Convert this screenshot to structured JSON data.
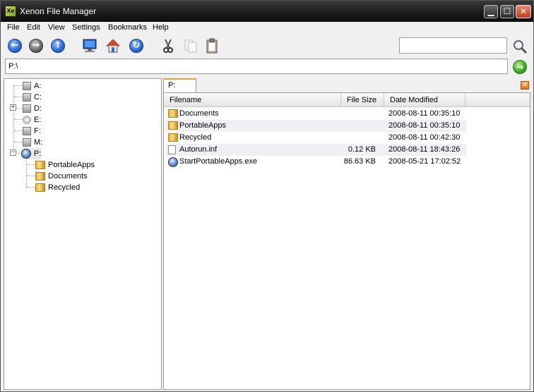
{
  "window": {
    "title": "Xenon File Manager",
    "app_icon_text": "Xe",
    "minimize_glyph": "▁",
    "maximize_glyph": "☐",
    "close_glyph": "✕"
  },
  "menu": [
    "File",
    "Edit",
    "View",
    "Settings",
    "Bookmarks",
    "Help"
  ],
  "toolbar": {
    "buttons": [
      {
        "name": "back",
        "icon": "arrow-left-icon",
        "glyph": "←"
      },
      {
        "name": "forward",
        "icon": "arrow-right-icon",
        "glyph": "→"
      },
      {
        "name": "up",
        "icon": "arrow-up-icon",
        "glyph": "↑"
      },
      {
        "name": "computer",
        "icon": "monitor-icon"
      },
      {
        "name": "home",
        "icon": "home-icon"
      },
      {
        "name": "refresh",
        "icon": "refresh-icon",
        "glyph": "↻"
      },
      {
        "name": "cut",
        "icon": "scissors-icon"
      },
      {
        "name": "copy",
        "icon": "copy-icon"
      },
      {
        "name": "paste",
        "icon": "clipboard-icon"
      }
    ],
    "search_value": "",
    "search_icon": "magnifier-icon"
  },
  "address": {
    "path": "P:\\",
    "go_icon": "go-arrow-icon",
    "go_glyph": "→"
  },
  "tree": {
    "drives": [
      {
        "label": "A:",
        "type": "drive",
        "expander": ""
      },
      {
        "label": "C:",
        "type": "drive",
        "expander": ""
      },
      {
        "label": "D:",
        "type": "drive",
        "expander": "+"
      },
      {
        "label": "E:",
        "type": "cd",
        "expander": ""
      },
      {
        "label": "F:",
        "type": "drive",
        "expander": ""
      },
      {
        "label": "M:",
        "type": "drive",
        "expander": ""
      },
      {
        "label": "P:",
        "type": "portable",
        "expander": "−"
      }
    ],
    "children": [
      "PortableApps",
      "Documents",
      "Recycled"
    ]
  },
  "tab": {
    "label": "P:",
    "close_glyph": "✕"
  },
  "list": {
    "columns": [
      "Filename",
      "File Size",
      "Date Modified"
    ],
    "rows": [
      {
        "name": "Documents",
        "size": "",
        "date": "2008-08-11 00:35:10",
        "icon": "folder-icon"
      },
      {
        "name": "PortableApps",
        "size": "",
        "date": "2008-08-11 00:35:10",
        "icon": "folder-icon"
      },
      {
        "name": "Recycled",
        "size": "",
        "date": "2008-08-11 00:42:30",
        "icon": "folder-icon"
      },
      {
        "name": "Autorun.inf",
        "size": "0.12 KB",
        "date": "2008-08-11 18:43:26",
        "icon": "document-icon"
      },
      {
        "name": "StartPortableApps.exe",
        "size": "86.63 KB",
        "date": "2008-05-21 17:02:52",
        "icon": "executable-icon"
      }
    ]
  }
}
